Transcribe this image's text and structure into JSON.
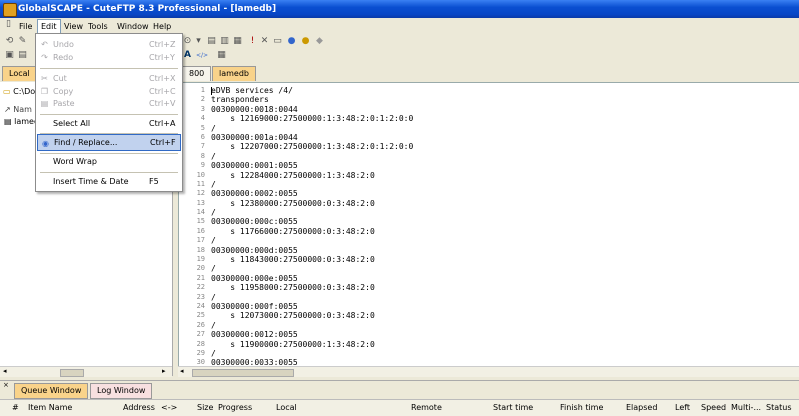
{
  "window": {
    "title": "GlobalSCAPE - CuteFTP 8.3 Professional - [lamedb]"
  },
  "menubar": [
    "File",
    "Edit",
    "View",
    "Tools",
    "Window",
    "Help"
  ],
  "tabs": {
    "remote1": "800",
    "remote2": "lamedb",
    "local": "Local"
  },
  "left_pane": {
    "path": "C:\\Do",
    "col_name": "Nam",
    "file": "lamed"
  },
  "edit_menu": {
    "undo": "Undo",
    "undo_sc": "Ctrl+Z",
    "redo": "Redo",
    "redo_sc": "Ctrl+Y",
    "cut": "Cut",
    "cut_sc": "Ctrl+X",
    "copy": "Copy",
    "copy_sc": "Ctrl+C",
    "paste": "Paste",
    "paste_sc": "Ctrl+V",
    "select_all": "Select All",
    "select_all_sc": "Ctrl+A",
    "find_replace": "Find / Replace...",
    "find_replace_sc": "Ctrl+F",
    "word_wrap": "Word Wrap",
    "insert_time": "Insert Time & Date",
    "insert_time_sc": "F5"
  },
  "editor": {
    "line_numbers": [
      "1",
      "2",
      "3",
      "4",
      "5",
      "6",
      "7",
      "8",
      "9",
      "10",
      "11",
      "12",
      "13",
      "14",
      "15",
      "16",
      "17",
      "18",
      "19",
      "20",
      "21",
      "22",
      "23",
      "24",
      "25",
      "26",
      "27",
      "28",
      "29",
      "30"
    ],
    "lines": [
      "eDVB services /4/",
      "transponders",
      "00300000:0018:0044",
      "    s 12169000:27500000:1:3:48:2:0:1:2:0:0",
      "/",
      "00300000:001a:0044",
      "    s 12207000:27500000:1:3:48:2:0:1:2:0:0",
      "/",
      "00300000:0001:0055",
      "    s 12284000:27500000:1:3:48:2:0",
      "/",
      "00300000:0002:0055",
      "    s 12380000:27500000:0:3:48:2:0",
      "/",
      "00300000:000c:0055",
      "    s 11766000:27500000:0:3:48:2:0",
      "/",
      "00300000:000d:0055",
      "    s 11843000:27500000:0:3:48:2:0",
      "/",
      "00300000:000e:0055",
      "    s 11958000:27500000:0:3:48:2:0",
      "/",
      "00300000:000f:0055",
      "    s 12073000:27500000:0:3:48:2:0",
      "/",
      "00300000:0012:0055",
      "    s 11900000:27500000:1:3:48:2:0",
      "/",
      "00300000:0033:0055"
    ]
  },
  "queue": {
    "tab_queue": "Queue Window",
    "tab_log": "Log Window",
    "headers": [
      "#",
      "Item Name",
      "Address",
      "<->",
      "Size",
      "Progress",
      "Local",
      "Remote",
      "Start time",
      "Finish time",
      "Elapsed",
      "Left",
      "Speed",
      "Multi-...",
      "Status"
    ]
  },
  "colors": {
    "title_bar": "#0a4fd1",
    "highlight": "#c1d2ee",
    "tab_selected": "#f9d38a"
  }
}
